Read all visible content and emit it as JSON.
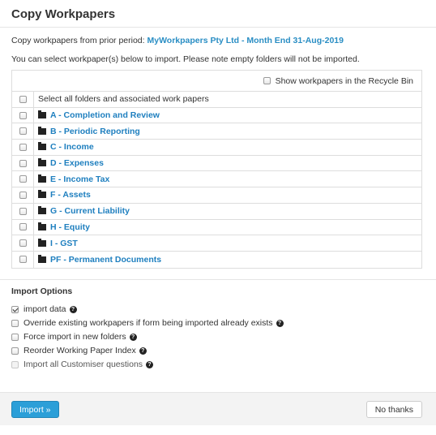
{
  "title": "Copy Workpapers",
  "intro": {
    "prefix": "Copy workpapers from prior period: ",
    "period": "MyWorkpapers Pty Ltd - Month End 31-Aug-2019",
    "note": "You can select workpaper(s) below to import. Please note empty folders will not be imported."
  },
  "recycle_bin_label": "Show workpapers in the Recycle Bin",
  "select_all_label": "Select all folders and associated work papers",
  "folders": [
    "A - Completion and Review",
    "B - Periodic Reporting",
    "C - Income",
    "D - Expenses",
    "E - Income Tax",
    "F - Assets",
    "G - Current Liability",
    "H - Equity",
    "I - GST",
    "PF - Permanent Documents"
  ],
  "import_options": {
    "heading": "Import Options",
    "options": [
      {
        "label": "import data",
        "checked": true,
        "disabled": false
      },
      {
        "label": "Override existing workpapers if form being imported already exists",
        "checked": false,
        "disabled": false
      },
      {
        "label": "Force import in new folders",
        "checked": false,
        "disabled": false
      },
      {
        "label": "Reorder Working Paper Index",
        "checked": false,
        "disabled": false
      },
      {
        "label": "Import all Customiser questions",
        "checked": false,
        "disabled": true
      }
    ]
  },
  "buttons": {
    "import": "Import »",
    "no_thanks": "No thanks"
  },
  "colors": {
    "link": "#1e7fbf",
    "primary": "#2b9fd8"
  }
}
